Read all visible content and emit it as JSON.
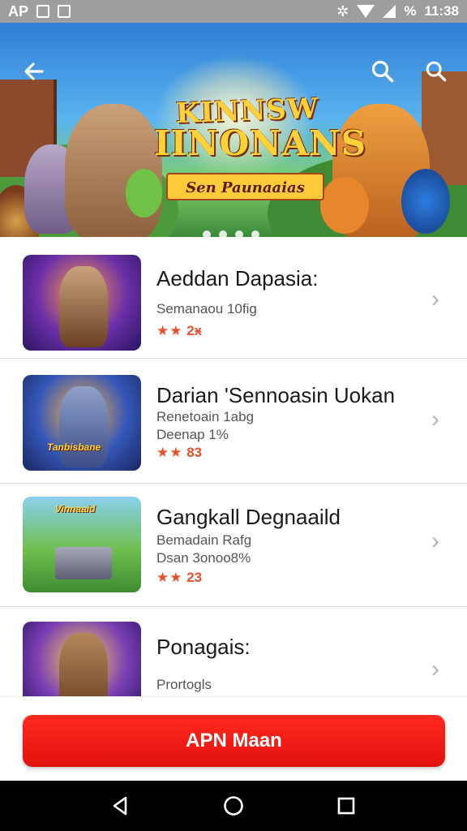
{
  "status_bar": {
    "left_text": "AP",
    "battery_text": "%",
    "time": "11:38",
    "icons": [
      "notification-box-icon",
      "image-icon",
      "settings-gear-icon",
      "wifi-icon",
      "signal-icon"
    ]
  },
  "banner": {
    "title_line1": "KINNSW",
    "title_line2": "IINONANS",
    "subtitle": "Sen Paunaaias",
    "dots_count": 4,
    "back_icon": "back-arrow-icon",
    "search_icons": [
      "search-icon",
      "search-icon"
    ]
  },
  "list": {
    "items": [
      {
        "title": "Aeddan Dapasia:",
        "line1": "Semanaou 10fig",
        "line2": "",
        "stars": "★★",
        "rating": "2ӿ"
      },
      {
        "title": "Darian 'Sennoasin Uokan",
        "line1": "Renetoain 1abg",
        "line2": "Deenap 1%",
        "stars": "★★",
        "rating": "83",
        "thumb_label": "Tanbisbane"
      },
      {
        "title": "Gangkall Degnaaild",
        "line1": "Bemadain Rafg",
        "line2": "Dsan 3onoo8%",
        "stars": "★★",
        "rating": "23",
        "thumb_label": "Vinnaaid"
      },
      {
        "title": "Ponagais:",
        "line1": "",
        "line2": "Prortogls",
        "stars": "",
        "rating": ""
      }
    ]
  },
  "cta": {
    "label": "APN Maan",
    "color": "#e8150f"
  },
  "nav": {
    "icons": [
      "back-triangle-icon",
      "home-circle-icon",
      "recents-square-icon"
    ]
  }
}
